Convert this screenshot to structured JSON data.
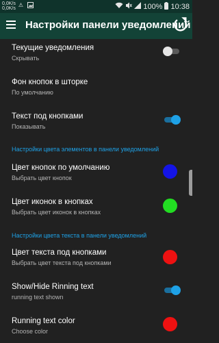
{
  "statusbar": {
    "speed_top": "0,0K/s",
    "speed_bottom": "0,0K/s",
    "battery": "100%",
    "time": "10:38"
  },
  "appbar": {
    "title": "Настройки панели уведомлений"
  },
  "rows": [
    {
      "title": "Текущие уведомления",
      "subtitle": "Скрывать",
      "control": "toggle",
      "on": false
    },
    {
      "title": "Фон кнопок в шторке",
      "subtitle": "По умолчанию"
    },
    {
      "title": "Текст под кнопками",
      "subtitle": "Показывать",
      "control": "toggle",
      "on": true
    },
    {
      "title": "Цвет кнопок по умолчанию",
      "subtitle": "Выбрать цвет кнопок",
      "control": "color",
      "color": "#1414e6"
    },
    {
      "title": "Цвет иконок в кнопках",
      "subtitle": "Выбрать цвет иконок в кнопках",
      "control": "color",
      "color": "#22dd22"
    },
    {
      "title": "Цвет текста под кнопками",
      "subtitle": "Выбрать цвет текста под кнопками",
      "control": "color",
      "color": "#ee1111"
    },
    {
      "title": "Show/Hide Rinning text",
      "subtitle": "running text shown",
      "control": "toggle",
      "on": true
    },
    {
      "title": "Running text color",
      "subtitle": "Choose color",
      "control": "color",
      "color": "#ee1111"
    }
  ],
  "sections": {
    "element_colors": "Настройки цвета элементов в панели уведомлений",
    "text_colors": "Настройки цвета текста в панели уведомлений"
  },
  "colors": {
    "accent": "#1ea1e6",
    "appbar": "#134337",
    "statusbar": "#0f332b",
    "background": "#212121"
  }
}
